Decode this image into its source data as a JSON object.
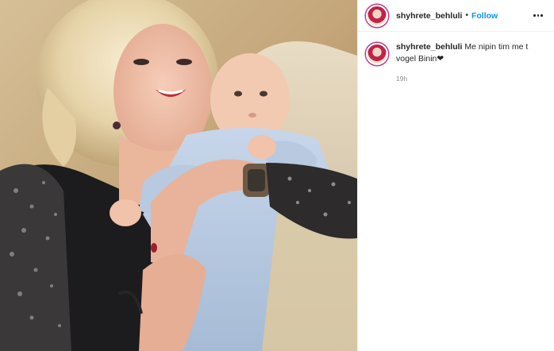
{
  "post": {
    "username": "shyhrete_behluli",
    "separator": "•",
    "follow_label": "Follow",
    "caption": {
      "username": "shyhrete_behluli",
      "text": "Me nipin tim me t vogel Binin",
      "emoji": "❤"
    },
    "timestamp": "19h"
  },
  "icons": {
    "more": "more-options-icon",
    "avatar": "profile-avatar"
  },
  "colors": {
    "link": "#0095f6",
    "text": "#262626",
    "muted": "#8e8e8e",
    "border": "#efefef"
  }
}
